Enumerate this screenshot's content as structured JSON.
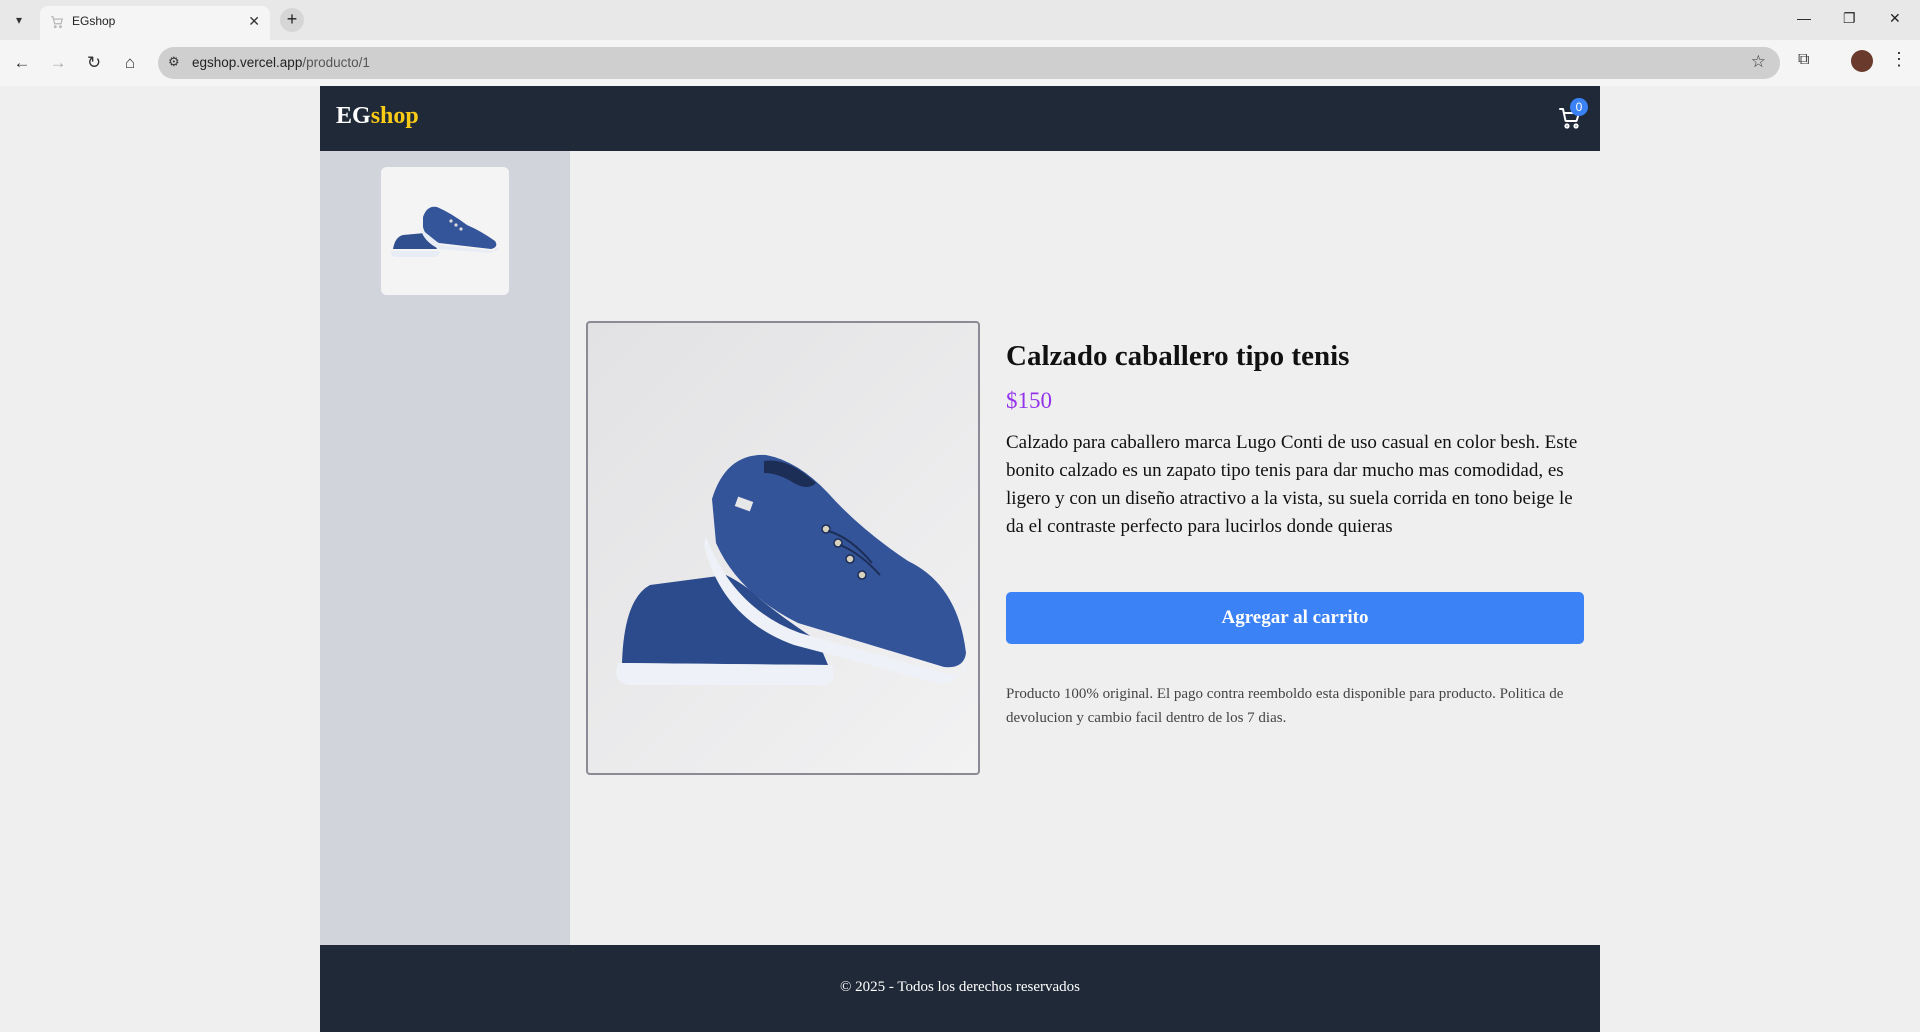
{
  "browser": {
    "tab_title": "EGshop",
    "tab_favicon": "cart-icon",
    "url_host": "egshop.vercel.app",
    "url_path": "/producto/1",
    "tab_menu_icon": "▾",
    "newtab_icon": "+",
    "close_icon": "✕",
    "minimize_icon": "—",
    "restore_icon": "❐",
    "back_icon": "←",
    "forward_icon": "→",
    "reload_icon": "↻",
    "home_icon": "⌂",
    "star_icon": "☆",
    "extensions_icon": "⧉",
    "menu_icon": "⋮",
    "site_info_icon": "⚙"
  },
  "header": {
    "logo_main": "EG",
    "logo_accent": "shop",
    "cart_count": "0"
  },
  "product": {
    "title": "Calzado caballero tipo tenis",
    "price": "$150",
    "description": "Calzado para caballero marca Lugo Conti de uso casual en color besh. Este bonito calzado es un zapato tipo tenis para dar mucho mas comodidad, es ligero y con un diseño atractivo a la vista, su suela corrida en tono beige le da el contraste perfecto para lucirlos donde quieras",
    "add_button": "Agregar al carrito",
    "note": "Producto 100% original. El pago contra reemboldo esta disponible para producto. Politica de devolucion y cambio facil dentro de los 7 dias.",
    "image": "blue-canvas-sneakers"
  },
  "footer": {
    "copyright": "© 2025 - Todos los derechos reservados"
  },
  "colors": {
    "header_bg": "#1f2937",
    "logo_accent": "#facc15",
    "price": "#9333ea",
    "button": "#3b82f6",
    "sidebar": "#d1d5db"
  }
}
